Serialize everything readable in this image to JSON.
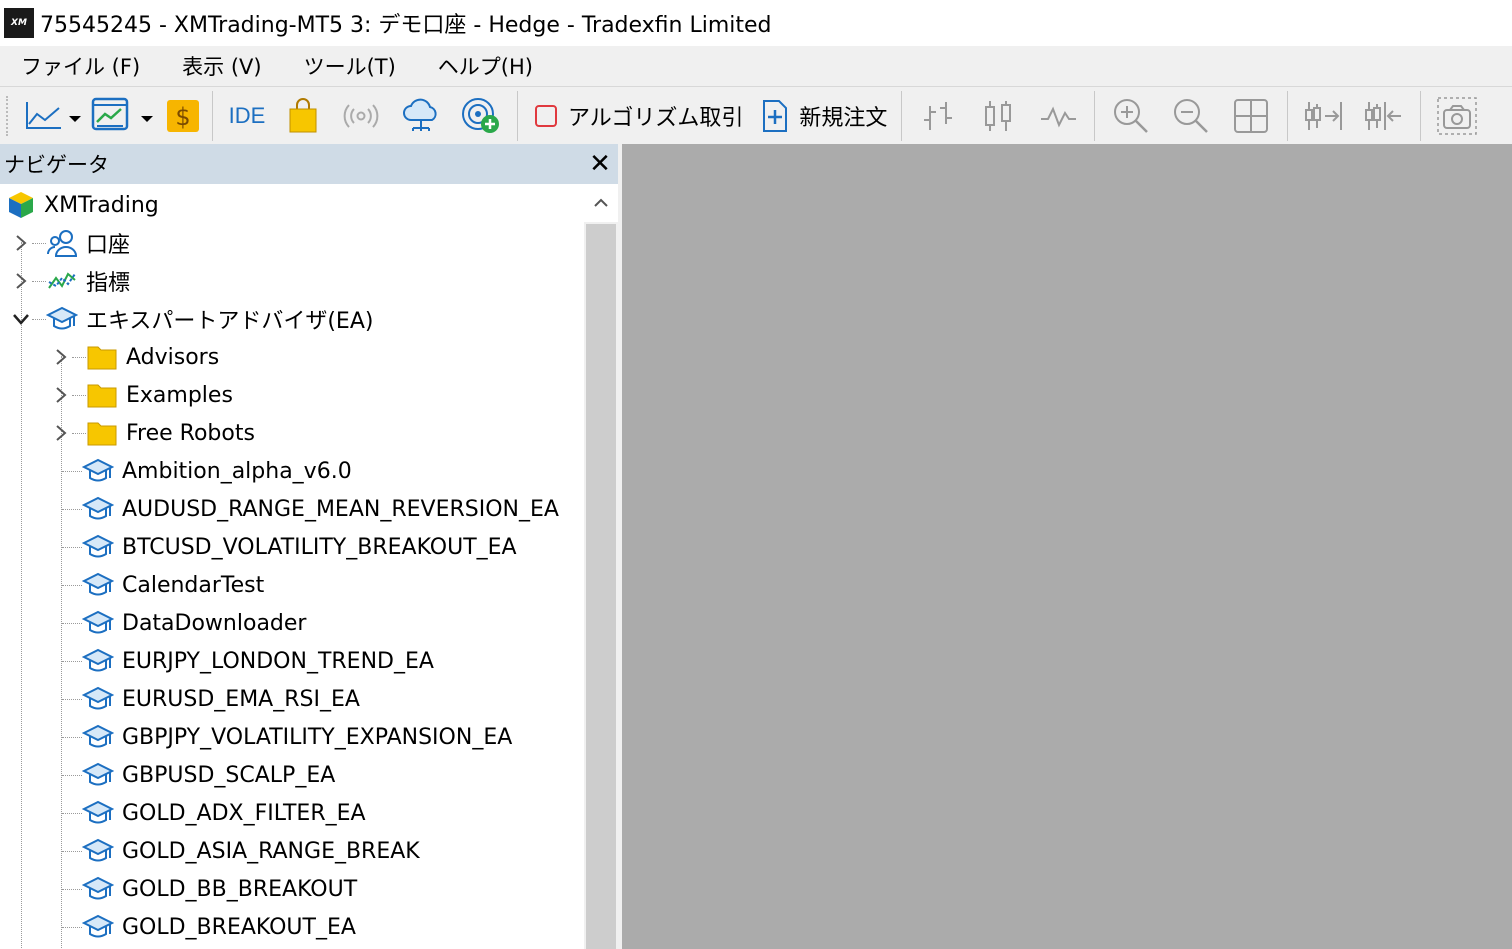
{
  "window": {
    "title": "75545245 - XMTrading-MT5 3: デモ口座 - Hedge - Tradexfin Limited",
    "logo_text": "XM"
  },
  "menu": {
    "items": [
      "ファイル (F)",
      "表示 (V)",
      "ツール(T)",
      "ヘルプ(H)"
    ]
  },
  "toolbar": {
    "ide_label": "IDE",
    "algo_label": "アルゴリズム取引",
    "new_order_label": "新規注文"
  },
  "navigator": {
    "title": "ナビゲータ",
    "close_glyph": "✕",
    "root": "XMTrading",
    "accounts": "口座",
    "indicators": "指標",
    "experts": "エキスパートアドバイザ(EA)",
    "folders": [
      "Advisors",
      "Examples",
      "Free Robots"
    ],
    "eas": [
      "Ambition_alpha_v6.0",
      "AUDUSD_RANGE_MEAN_REVERSION_EA",
      "BTCUSD_VOLATILITY_BREAKOUT_EA",
      "CalendarTest",
      "DataDownloader",
      "EURJPY_LONDON_TREND_EA",
      "EURUSD_EMA_RSI_EA",
      "GBPJPY_VOLATILITY_EXPANSION_EA",
      "GBPUSD_SCALP_EA",
      "GOLD_ADX_FILTER_EA",
      "GOLD_ASIA_RANGE_BREAK",
      "GOLD_BB_BREAKOUT",
      "GOLD_BREAKOUT_EA"
    ]
  },
  "colors": {
    "accent_blue": "#1c6fc1",
    "folder_yellow": "#f7c600",
    "main_area": "#ababab",
    "nav_header": "#cfdbe6"
  }
}
